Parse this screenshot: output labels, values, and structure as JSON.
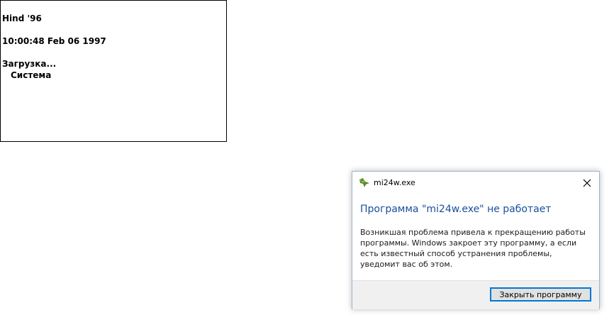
{
  "console": {
    "lines": [
      "Hind '96",
      "10:00:48 Feb 06 1997",
      "Загрузка...",
      "Система"
    ]
  },
  "dialog": {
    "title": "mi24w.exe",
    "heading": "Программа \"mi24w.exe\" не работает",
    "body": "Возникшая проблема привела к прекращению работы программы. Windows закроет эту программу, а если есть известный способ устранения проблемы, уведомит вас об этом.",
    "close_button_label": "Закрыть программу",
    "app_icon": "app-icon",
    "close_icon": "close-icon",
    "heading_color": "#1a4f9c",
    "button_border_color": "#0078d7"
  }
}
